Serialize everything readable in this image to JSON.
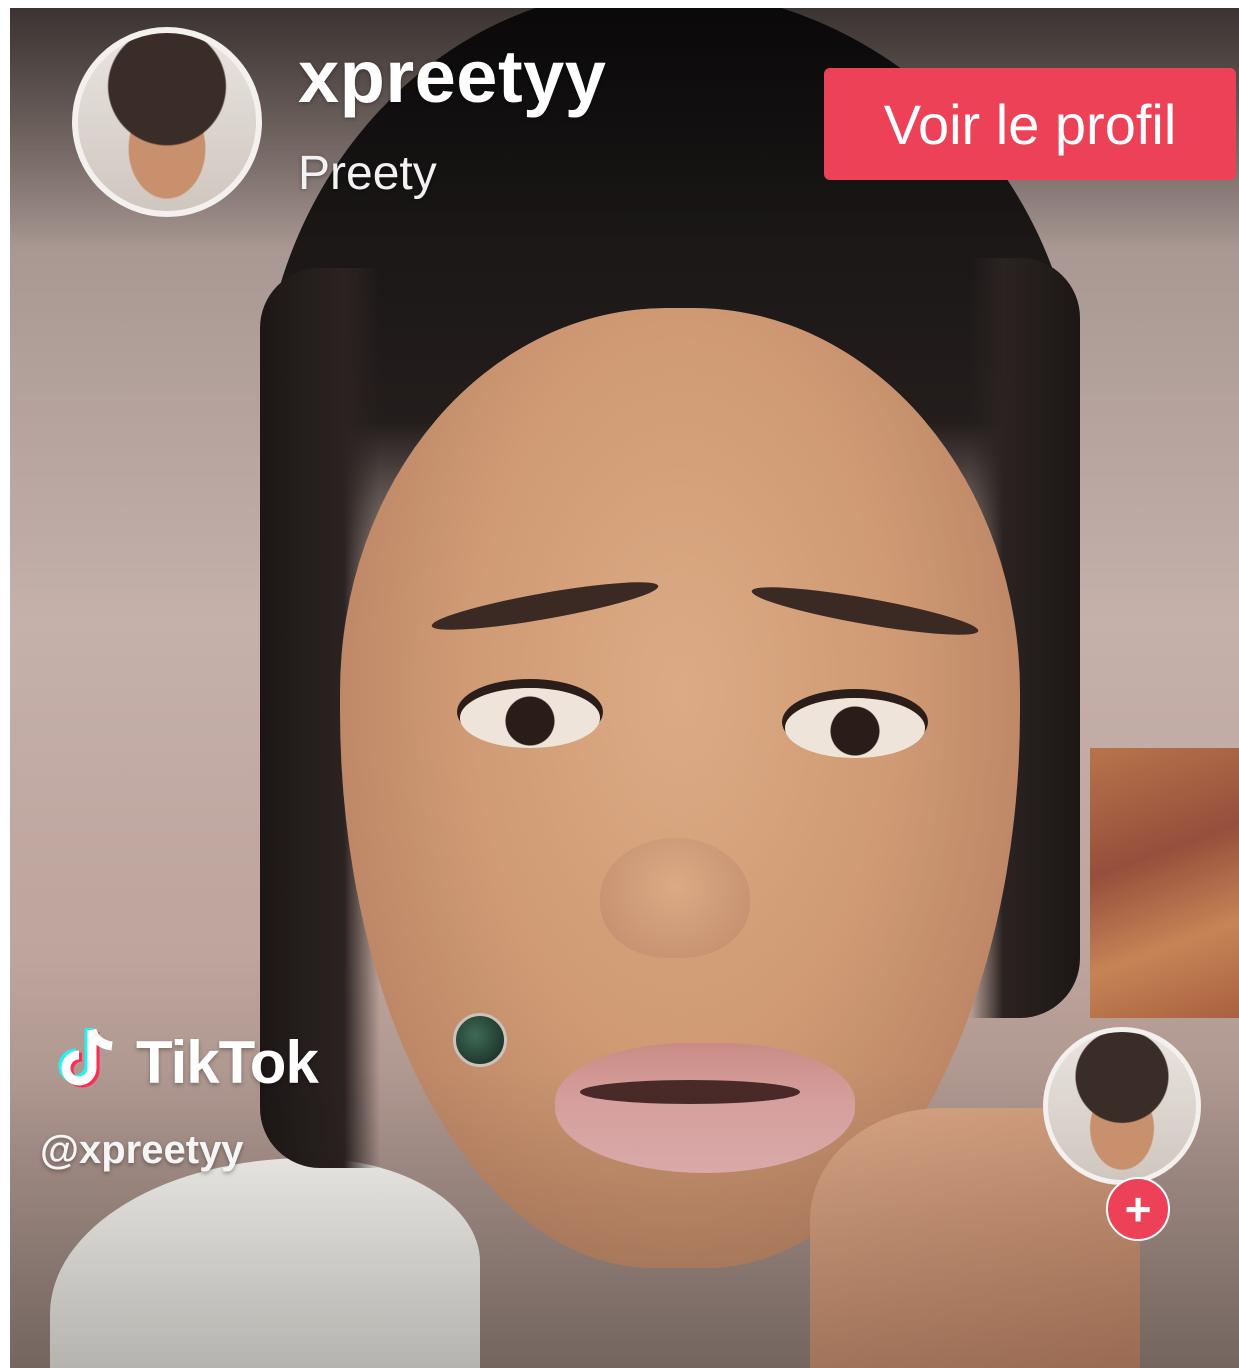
{
  "header": {
    "username": "xpreetyy",
    "display_name": "Preety",
    "avatar_icon": "user-avatar-icon"
  },
  "actions": {
    "view_profile_label": "Voir le profil",
    "follow_symbol": "+"
  },
  "watermark": {
    "brand": "TikTok",
    "handle": "@xpreetyy",
    "logo_icon": "tiktok-logo-icon"
  },
  "colors": {
    "accent": "#ec4156",
    "text": "#ffffff"
  }
}
